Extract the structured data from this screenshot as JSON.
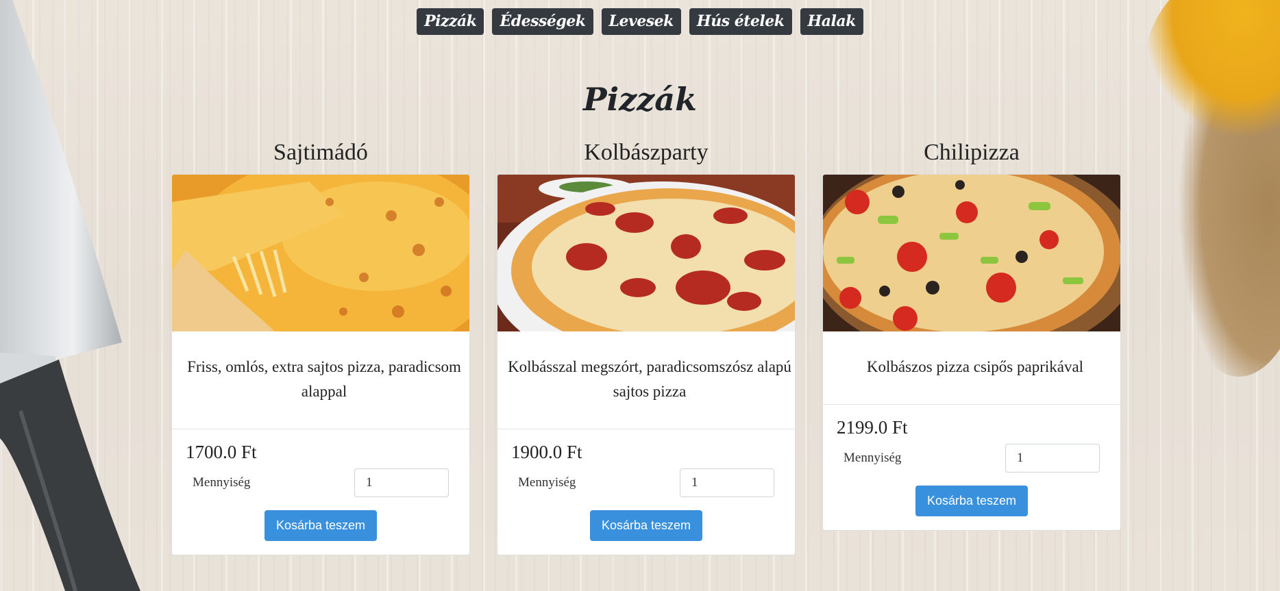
{
  "nav": {
    "items": [
      "Pizzák",
      "Édességek",
      "Levesek",
      "Hús ételek",
      "Halak"
    ]
  },
  "page": {
    "title": "Pizzák"
  },
  "products": [
    {
      "name": "Sajtimádó",
      "description": "Friss, omlós, extra sajtos pizza, paradicsom alappal",
      "price": "1700.0 Ft",
      "quantity_label": "Mennyiség",
      "quantity_value": "1",
      "button": "Kosárba teszem",
      "image": "cheese-pizza-image"
    },
    {
      "name": "Kolbászparty",
      "description": "Kolbásszal megszórt, paradicsomszósz alapú sajtos pizza",
      "price": "1900.0 Ft",
      "quantity_label": "Mennyiség",
      "quantity_value": "1",
      "button": "Kosárba teszem",
      "image": "salami-pizza-image"
    },
    {
      "name": "Chilipizza",
      "description": "Kolbászos pizza csipős paprikával",
      "price": "2199.0 Ft",
      "quantity_label": "Mennyiség",
      "quantity_value": "1",
      "button": "Kosárba teszem",
      "image": "chili-pizza-image"
    }
  ],
  "colors": {
    "nav_bg": "#343a40",
    "button_bg": "#3990dc",
    "background": "#e8e1d8"
  }
}
